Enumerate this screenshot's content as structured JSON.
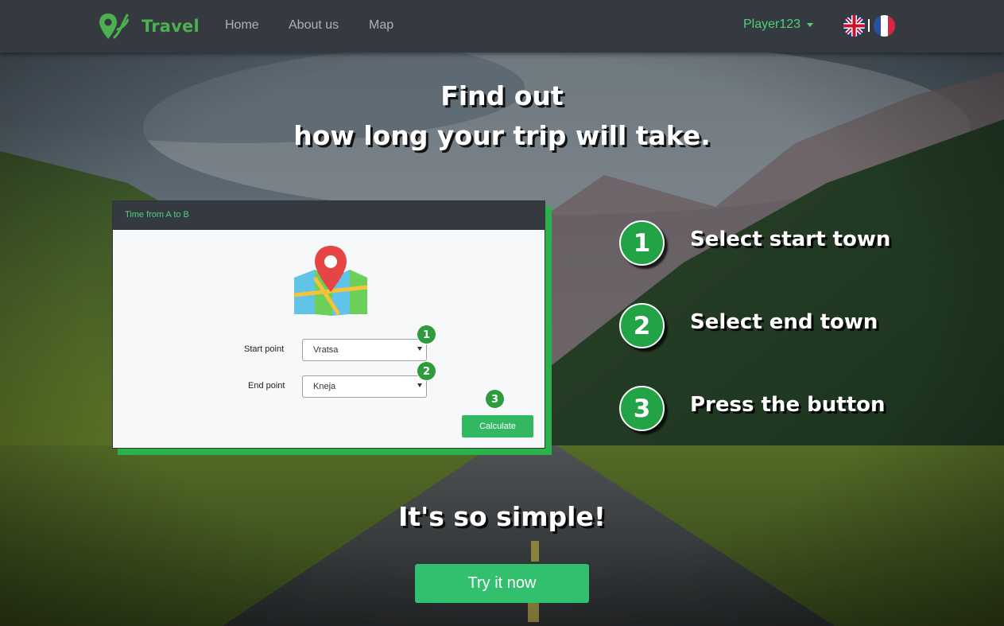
{
  "navbar": {
    "brand": "Travel",
    "links": [
      {
        "label": "Home"
      },
      {
        "label": "About us"
      },
      {
        "label": "Map"
      }
    ],
    "user": "Player123",
    "languages": [
      "en",
      "fr"
    ]
  },
  "hero": {
    "line1": "Find out",
    "line2": "how long your trip will take.",
    "tagline": "It's so simple!",
    "cta": "Try it now"
  },
  "card": {
    "header": "Time from A to B",
    "start_label": "Start point",
    "start_value": "Vratsa",
    "end_label": "End point",
    "end_value": "Kneja",
    "button": "Calculate",
    "badges": [
      "1",
      "2",
      "3"
    ]
  },
  "steps": [
    {
      "num": "1",
      "text": "Select start town"
    },
    {
      "num": "2",
      "text": "Select end town"
    },
    {
      "num": "3",
      "text": "Press the button"
    }
  ],
  "colors": {
    "accent": "#32b860",
    "navbar": "#343a40",
    "brand": "#4caf50"
  }
}
